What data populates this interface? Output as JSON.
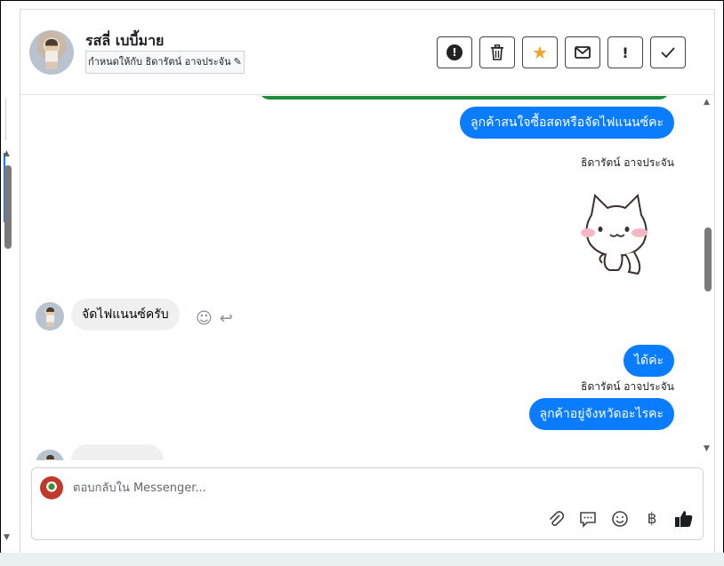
{
  "header": {
    "contact_name": "รสลี่ เบบี้มาย",
    "assigned_to": "กำหนดให้กับ ธิดารัตน์ อาจประจัน",
    "actions": [
      {
        "name": "mark-spam-button",
        "icon": "alert-circle-icon"
      },
      {
        "name": "delete-button",
        "icon": "trash-icon"
      },
      {
        "name": "star-button",
        "icon": "star-icon"
      },
      {
        "name": "mark-unread-button",
        "icon": "envelope-icon"
      },
      {
        "name": "follow-up-button",
        "icon": "exclamation-icon"
      },
      {
        "name": "mark-done-button",
        "icon": "check-icon"
      }
    ]
  },
  "messages": {
    "out_1": "ลูกค้าสนใจซื้อสดหรือจัดไฟแนนซ์คะ",
    "sender_1": "ธิดารัตน์ อาจประจัน",
    "in_1": "จัดไฟแนนซ์ครับ",
    "out_2": "ได้ค่ะ",
    "sender_2": "ธิดารัตน์ อาจประจัน",
    "out_3": "ลูกค้าอยู่จังหวัดอะไรคะ"
  },
  "composer": {
    "placeholder": "ตอบกลับใน Messenger...",
    "tools": [
      "paperclip-icon",
      "chat-bubble-icon",
      "emoji-icon",
      "baht-icon",
      "thumbs-up-icon"
    ]
  },
  "colors": {
    "outgoing_bubble": "#0a7cff",
    "incoming_bubble": "#f0f0f0",
    "star": "#f0a22e"
  }
}
